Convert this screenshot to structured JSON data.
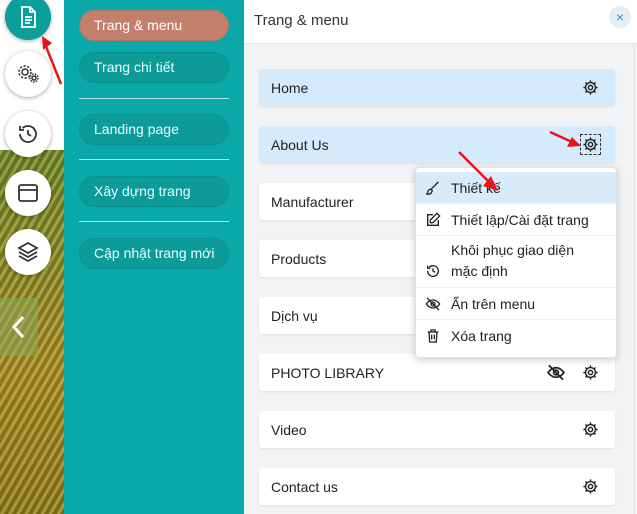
{
  "menu": {
    "items": [
      {
        "label": "Trang & menu"
      },
      {
        "label": "Trang chi tiết"
      },
      {
        "label": "Landing page"
      },
      {
        "label": "Xây dựng trang"
      },
      {
        "label": "Cập nhật trang mới"
      }
    ]
  },
  "panel": {
    "title": "Trang & menu",
    "close_glyph": "×",
    "pages": [
      {
        "label": "Home"
      },
      {
        "label": "About Us"
      },
      {
        "label": "Manufacturer"
      },
      {
        "label": "Products"
      },
      {
        "label": "Dịch vụ"
      },
      {
        "label": "PHOTO LIBRARY"
      },
      {
        "label": "Video"
      },
      {
        "label": "Contact us"
      }
    ]
  },
  "dropdown": {
    "design": "Thiết kế",
    "settings": "Thiết lập/Cài đặt trang",
    "restore_line1": "Khôi phục giao diện",
    "restore_line2": "mặc định",
    "hide": "Ẩn trên menu",
    "delete": "Xóa trang"
  },
  "colors": {
    "menu_bg": "#0aa8a8",
    "menu_active": "#c17f6c",
    "highlight_row": "#d5ebfb",
    "arrow_red": "#e8141c"
  },
  "icons": [
    "document-icon",
    "gear-cluster-icon",
    "history-icon",
    "layout-icon",
    "layers-icon",
    "chevron-left-icon",
    "gear-icon",
    "eye-slash-icon",
    "brush-icon",
    "edit-icon",
    "restore-icon",
    "trash-icon"
  ]
}
